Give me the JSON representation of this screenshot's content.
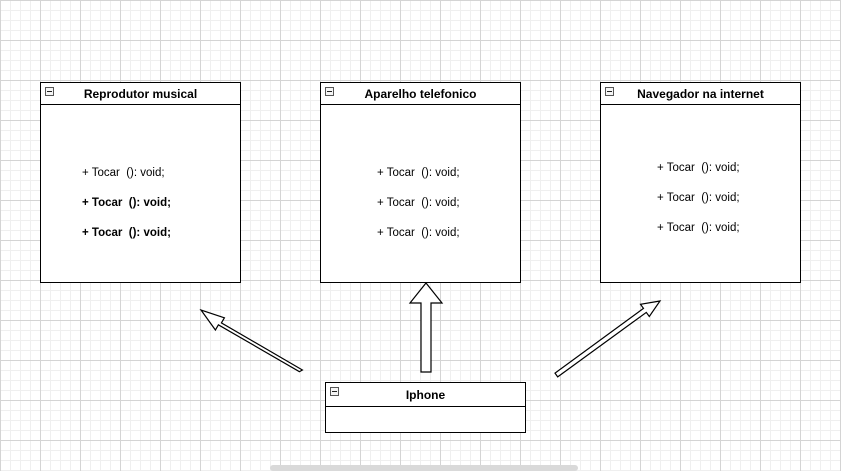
{
  "classes": {
    "reprodutor": {
      "name": "Reprodutor musical",
      "methods": [
        "+ Tocar  (): void;",
        "+ Tocar  (): void;",
        "+ Tocar  (): void;"
      ]
    },
    "aparelho": {
      "name": "Aparelho telefonico",
      "methods": [
        "+ Tocar  (): void;",
        "+ Tocar  (): void;",
        "+ Tocar  (): void;"
      ]
    },
    "navegador": {
      "name": "Navegador na internet",
      "methods": [
        "+ Tocar  (): void;",
        "+ Tocar  (): void;",
        "+ Tocar  (): void;"
      ]
    },
    "iphone": {
      "name": "Iphone"
    }
  },
  "colors": {
    "grid_major": "#d4d4d4",
    "grid_minor": "#efefef",
    "stroke": "#000000"
  },
  "icons": {
    "collapse": "minus-square-icon"
  }
}
